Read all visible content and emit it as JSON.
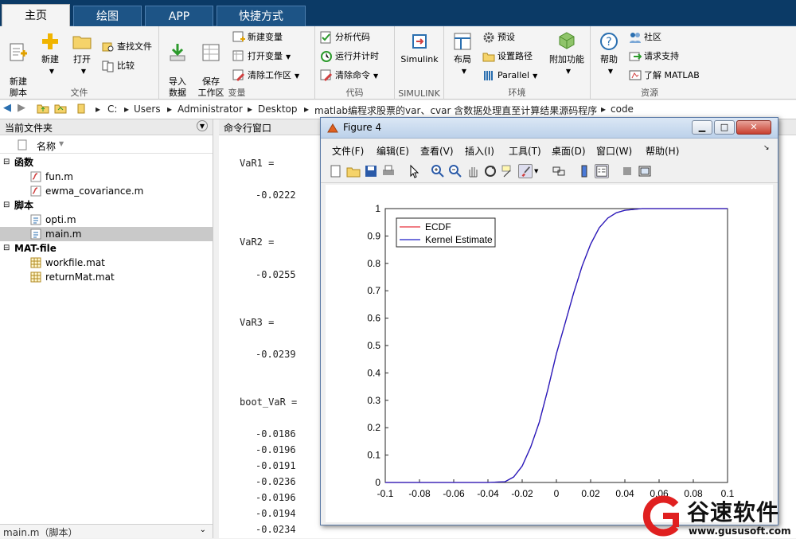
{
  "tabs": [
    "主页",
    "绘图",
    "APP",
    "快捷方式"
  ],
  "ribbon": {
    "file": {
      "label": "文件",
      "new_script": "新建\n脚本",
      "new": "新建",
      "open": "打开",
      "find_files": "查找文件",
      "compare": "比较"
    },
    "variable": {
      "label": "变量",
      "import_data": "导入\n数据",
      "save_workspace": "保存\n工作区",
      "new_variable": "新建变量",
      "open_variable": "打开变量",
      "clear_workspace": "清除工作区"
    },
    "code": {
      "label": "代码",
      "analyze_code": "分析代码",
      "run_and_time": "运行并计时",
      "clear_commands": "清除命令"
    },
    "simulink": {
      "label": "SIMULINK",
      "simulink": "Simulink"
    },
    "environment": {
      "label": "环境",
      "layout": "布局",
      "preferences": "预设",
      "set_path": "设置路径",
      "parallel": "Parallel",
      "addons": "附加功能"
    },
    "resources": {
      "label": "资源",
      "help": "帮助",
      "community": "社区",
      "request_support": "请求支持",
      "learn_matlab": "了解 MATLAB"
    }
  },
  "address": {
    "parts": [
      "C:",
      "Users",
      "Administrator",
      "Desktop",
      "matlab编程求股票的var、cvar 含数据处理直至计算结果源码程序",
      "code"
    ]
  },
  "file_panel": {
    "title": "当前文件夹",
    "column_header": "名称",
    "groups": [
      {
        "name": "函数",
        "items": [
          "fun.m",
          "ewma_covariance.m"
        ]
      },
      {
        "name": "脚本",
        "items": [
          "opti.m",
          "main.m"
        ]
      },
      {
        "name": "MAT-file",
        "items": [
          "workfile.mat",
          "returnMat.mat"
        ]
      }
    ],
    "status": "main.m（脚本）"
  },
  "command_window": {
    "title": "命令行窗口",
    "lines": [
      "VaR1 =",
      "-0.0222",
      "VaR2 =",
      "-0.0255",
      "VaR3 =",
      "-0.0239",
      "boot_VaR =",
      "-0.0186",
      "-0.0196",
      "-0.0191",
      "-0.0236",
      "-0.0196",
      "-0.0194",
      "-0.0234"
    ]
  },
  "figure": {
    "title": "Figure 4",
    "menu": [
      "文件(F)",
      "编辑(E)",
      "查看(V)",
      "插入(I)",
      "工具(T)",
      "桌面(D)",
      "窗口(W)",
      "帮助(H)"
    ],
    "toolbar_icons": [
      "new-figure-icon",
      "open-file-icon",
      "save-icon",
      "print-icon",
      "pointer-icon",
      "zoom-in-icon",
      "zoom-out-icon",
      "pan-icon",
      "rotate-icon",
      "data-cursor-icon",
      "brush-icon",
      "link-icon",
      "colorbar-icon",
      "legend-icon",
      "hide-axes-icon",
      "show-axes-icon"
    ]
  },
  "chart_data": {
    "type": "line",
    "xlabel": "",
    "ylabel": "",
    "title": "",
    "xlim": [
      -0.1,
      0.1
    ],
    "ylim": [
      0,
      1
    ],
    "xticks": [
      "-0.1",
      "-0.08",
      "-0.06",
      "-0.04",
      "-0.02",
      "0",
      "0.02",
      "0.04",
      "0.06",
      "0.08",
      "0.1"
    ],
    "yticks": [
      "0",
      "0.1",
      "0.2",
      "0.3",
      "0.4",
      "0.5",
      "0.6",
      "0.7",
      "0.8",
      "0.9",
      "1"
    ],
    "legend_position": "top-left",
    "series": [
      {
        "name": "ECDF",
        "color": "#e8323c",
        "x": [
          -0.1,
          -0.04,
          -0.03,
          -0.025,
          -0.02,
          -0.015,
          -0.01,
          -0.005,
          0,
          0.005,
          0.01,
          0.015,
          0.02,
          0.025,
          0.03,
          0.035,
          0.04,
          0.05,
          0.1
        ],
        "y": [
          0,
          0,
          0.003,
          0.02,
          0.06,
          0.13,
          0.22,
          0.34,
          0.47,
          0.58,
          0.69,
          0.79,
          0.87,
          0.93,
          0.965,
          0.985,
          0.994,
          1,
          1
        ]
      },
      {
        "name": "Kernel Estimate",
        "color": "#1e1ec8",
        "x": [
          -0.1,
          -0.04,
          -0.03,
          -0.025,
          -0.02,
          -0.015,
          -0.01,
          -0.005,
          0,
          0.005,
          0.01,
          0.015,
          0.02,
          0.025,
          0.03,
          0.035,
          0.04,
          0.05,
          0.1
        ],
        "y": [
          0,
          0,
          0.003,
          0.02,
          0.06,
          0.13,
          0.22,
          0.34,
          0.47,
          0.58,
          0.69,
          0.79,
          0.87,
          0.93,
          0.965,
          0.985,
          0.994,
          1,
          1
        ]
      }
    ]
  },
  "watermark": {
    "brand": "谷速软件",
    "url": "www.gususoft.com"
  }
}
